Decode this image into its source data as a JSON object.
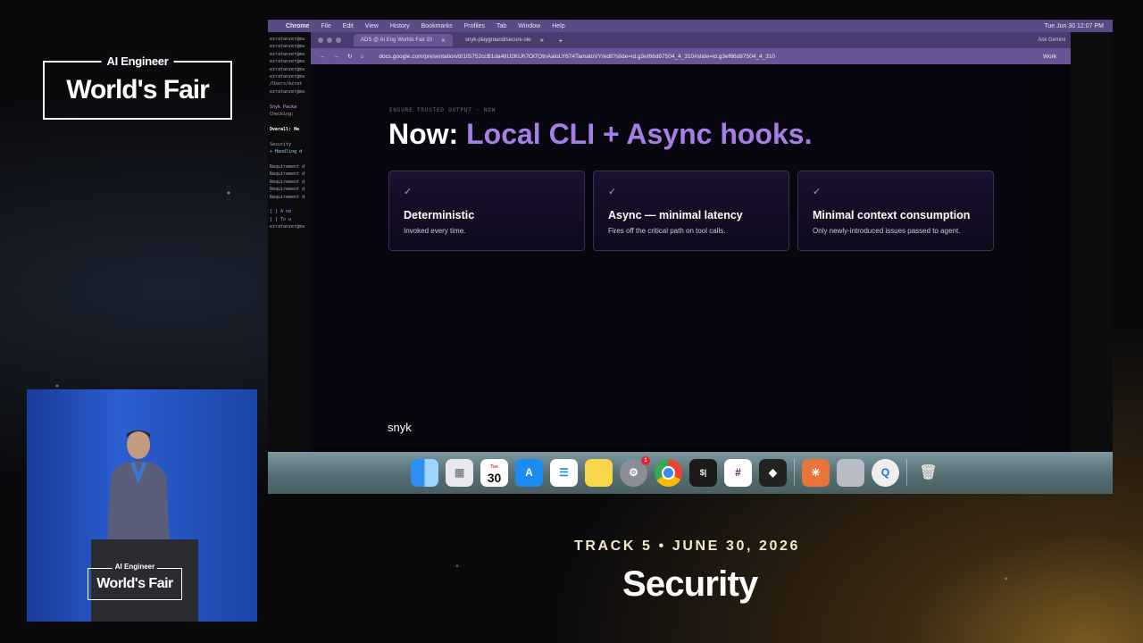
{
  "event": {
    "logo_small": "AI Engineer",
    "logo_big": "World's Fair"
  },
  "podium": {
    "logo_small": "AI Engineer",
    "logo_big": "World's Fair"
  },
  "menubar": {
    "app": "Chrome",
    "items": [
      "File",
      "Edit",
      "View",
      "History",
      "Bookmarks",
      "Profiles",
      "Tab",
      "Window",
      "Help"
    ],
    "clock": "Tue Jun 30 12:07 PM"
  },
  "terminal": {
    "lines": [
      "ezratanzer@ma",
      "ezratanzer@ma",
      "ezratanzer@ma",
      "ezratanzer@ma",
      "ezratanzer@ma",
      "ezratanzer@ma",
      "/Users/ezrat",
      "ezratanzer@ma",
      "",
      "Snyk Packa",
      "Checking:",
      "",
      "Overall: He",
      "",
      "Security",
      "+ Handling d",
      "",
      "Requirement d",
      "Requirement d",
      "Requirement d",
      "Requirement d",
      "Requirement d",
      "",
      "[      ] A ne",
      "[      ] To u",
      "ezratanzer@ma"
    ]
  },
  "browser": {
    "tabs": [
      {
        "label": "ADS @ AI Eng Worlds Fair 20",
        "active": true
      },
      {
        "label": "snyk-playground/secure-sle",
        "active": false
      }
    ],
    "ask_gemini": "Ask Gemini",
    "url": "docs.google.com/presentation/d/1IS752ccB1da4lIU2KUh7Ol7OtnAaloLY674TamatoVY/edit?slide=id.g3ef66d87504_4_310#slide=id.g3ef66d87504_4_310",
    "profile": "Work"
  },
  "slide": {
    "eyebrow": "ENSURE TRUSTED OUTPUT · NOW",
    "title_prefix": "Now:",
    "title_highlight": "Local CLI + Async hooks.",
    "check": "✓",
    "cards": [
      {
        "heading": "Deterministic",
        "desc": "Invoked every time."
      },
      {
        "heading": "Async — minimal latency",
        "desc": "Fires off the critical path on tool calls."
      },
      {
        "heading": "Minimal context consumption",
        "desc": "Only newly-introduced issues passed to agent."
      }
    ],
    "brand": "snyk"
  },
  "dock": {
    "calendar_month": "Tue",
    "calendar_day": "30",
    "badge_count": "1",
    "terminal_glyph": "$|"
  },
  "lower_third": {
    "track": "TRACK 5 • JUNE 30, 2026",
    "topic": "Security"
  }
}
